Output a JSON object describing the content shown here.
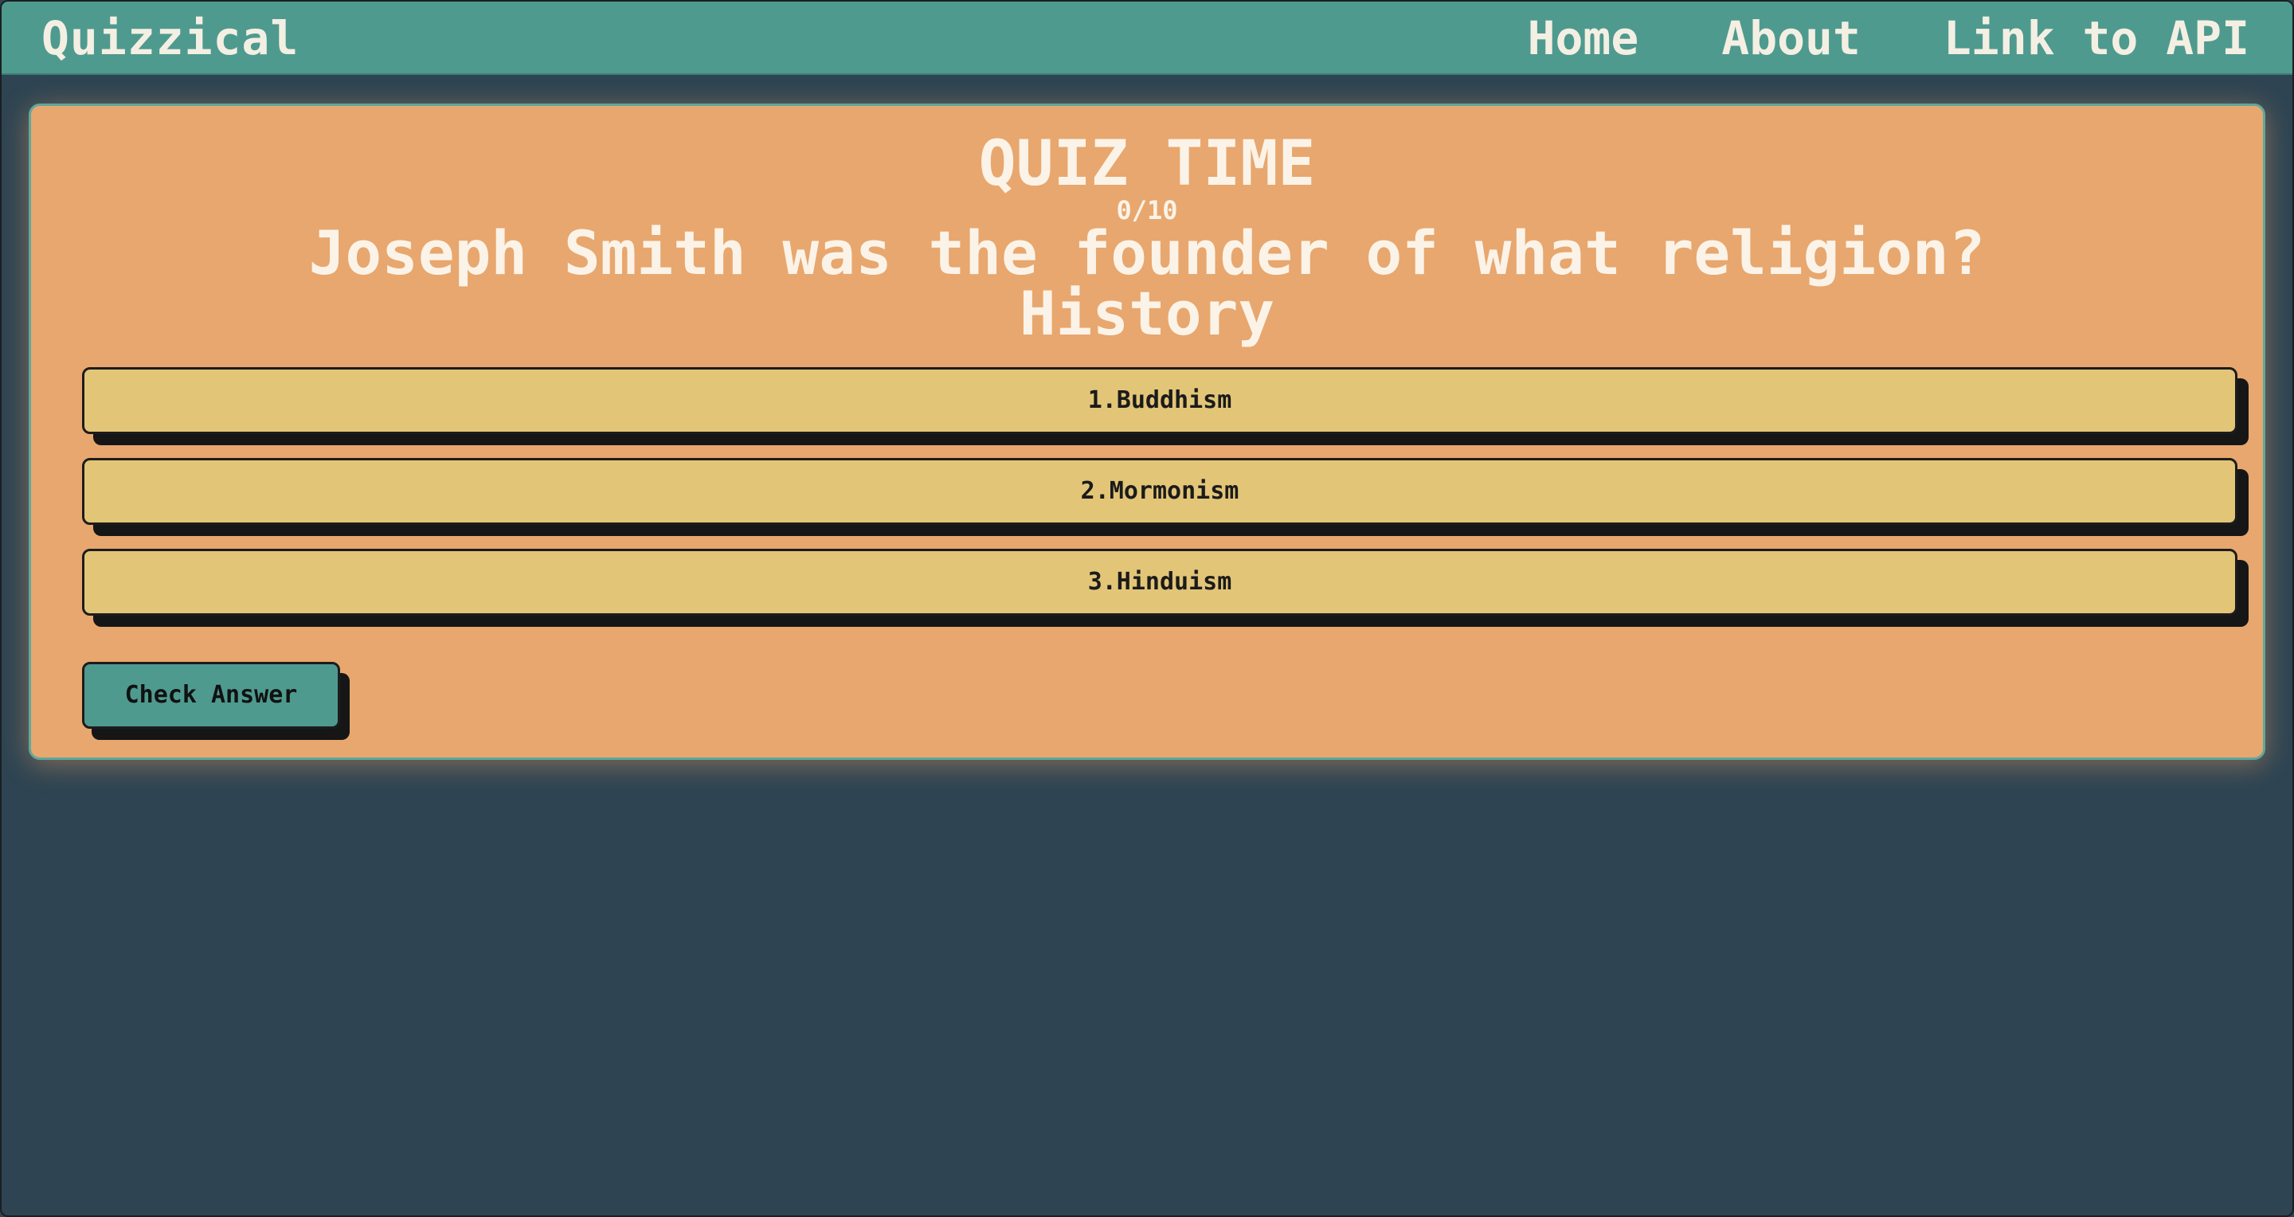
{
  "nav": {
    "brand": "Quizzical",
    "links": [
      "Home",
      "About",
      "Link to API"
    ]
  },
  "quiz": {
    "title": "QUIZ TIME",
    "progress": "0/10",
    "question": "Joseph Smith was the founder of what religion?",
    "category": "History",
    "answers": [
      "1.Buddhism",
      "2.Mormonism",
      "3.Hinduism"
    ],
    "check_label": "Check Answer"
  },
  "colors": {
    "background": "#2e4452",
    "navbar": "#4f9a8f",
    "card": "#e8a76e",
    "answer": "#e2c577",
    "button": "#4f9a8f"
  }
}
